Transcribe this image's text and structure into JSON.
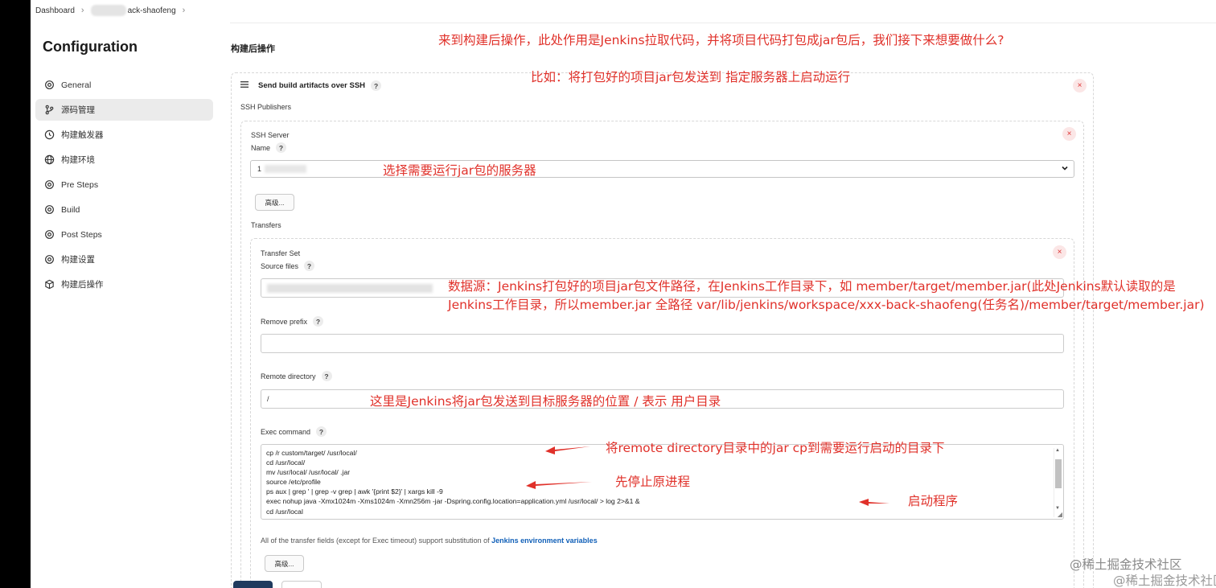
{
  "breadcrumb": {
    "home": "Dashboard",
    "job": "ack-shaofeng"
  },
  "sidebar": {
    "title": "Configuration",
    "items": [
      {
        "label": "General",
        "icon": "gear-icon",
        "active": false
      },
      {
        "label": "源码管理",
        "icon": "branch-icon",
        "active": true
      },
      {
        "label": "构建触发器",
        "icon": "clock-icon",
        "active": false
      },
      {
        "label": "构建环境",
        "icon": "globe-icon",
        "active": false
      },
      {
        "label": "Pre Steps",
        "icon": "gear-icon",
        "active": false
      },
      {
        "label": "Build",
        "icon": "gear-icon",
        "active": false
      },
      {
        "label": "Post Steps",
        "icon": "gear-icon",
        "active": false
      },
      {
        "label": "构建设置",
        "icon": "gear-icon",
        "active": false
      },
      {
        "label": "构建后操作",
        "icon": "cube-icon",
        "active": false
      }
    ]
  },
  "main": {
    "section_title": "构建后操作",
    "step_title": "Send build artifacts over SSH",
    "ssh_publishers_label": "SSH Publishers",
    "ssh_server_label": "SSH Server",
    "name_label": "Name",
    "server_name_value": "1",
    "advanced_label": "高级...",
    "transfers_label": "Transfers",
    "transfer_set_label": "Transfer Set",
    "source_files_label": "Source files",
    "remove_prefix_label": "Remove prefix",
    "remote_directory_label": "Remote directory",
    "remote_directory_value": "/",
    "exec_command_label": "Exec command",
    "exec_command_lines": [
      "cp /r          custom/target/               /usr/local/",
      "cd  /usr/local/",
      "mv /usr/local/                     /usr/local/                 .jar",
      "source /etc/profile",
      "ps aux | grep '           | grep -v grep | awk '{print $2}' | xargs kill -9",
      "exec  nohup java -Xmx1024m -Xms1024m -Xmn256m -jar  -Dspring.config.location=application.yml /usr/local/                          >           log 2>&1 &",
      "cd  /usr/local"
    ],
    "hint_prefix": "All of the transfer fields (except for Exec timeout) support substitution of ",
    "hint_link": "Jenkins environment variables",
    "help_glyph": "?",
    "close_glyph": "×"
  },
  "annotations": {
    "note1": "来到构建后操作，此处作用是Jenkins拉取代码，并将项目代码打包成jar包后，我们接下来想要做什么?",
    "note2": "比如：将打包好的项目jar包发送到 指定服务器上启动运行",
    "note3": "选择需要运行jar包的服务器",
    "note4": "数据源：Jenkins打包好的项目jar包文件路径，在Jenkins工作目录下，如 member/target/member.jar(此处Jenkins默认读取的是Jenkins工作目录，所以member.jar 全路径 var/lib/jenkins/workspace/xxx-back-shaofeng(任务名)/member/target/member.jar)",
    "note5": "这里是Jenkins将jar包发送到目标服务器的位置  / 表示 用户目录",
    "note6": "将remote directory目录中的jar cp到需要运行启动的目录下",
    "note7": "先停止原进程",
    "note8": "启动程序",
    "color": "#e0312a"
  },
  "watermark": {
    "text1": "@稀土掘金技术社区",
    "text2": "@稀土掘金技术社区"
  }
}
